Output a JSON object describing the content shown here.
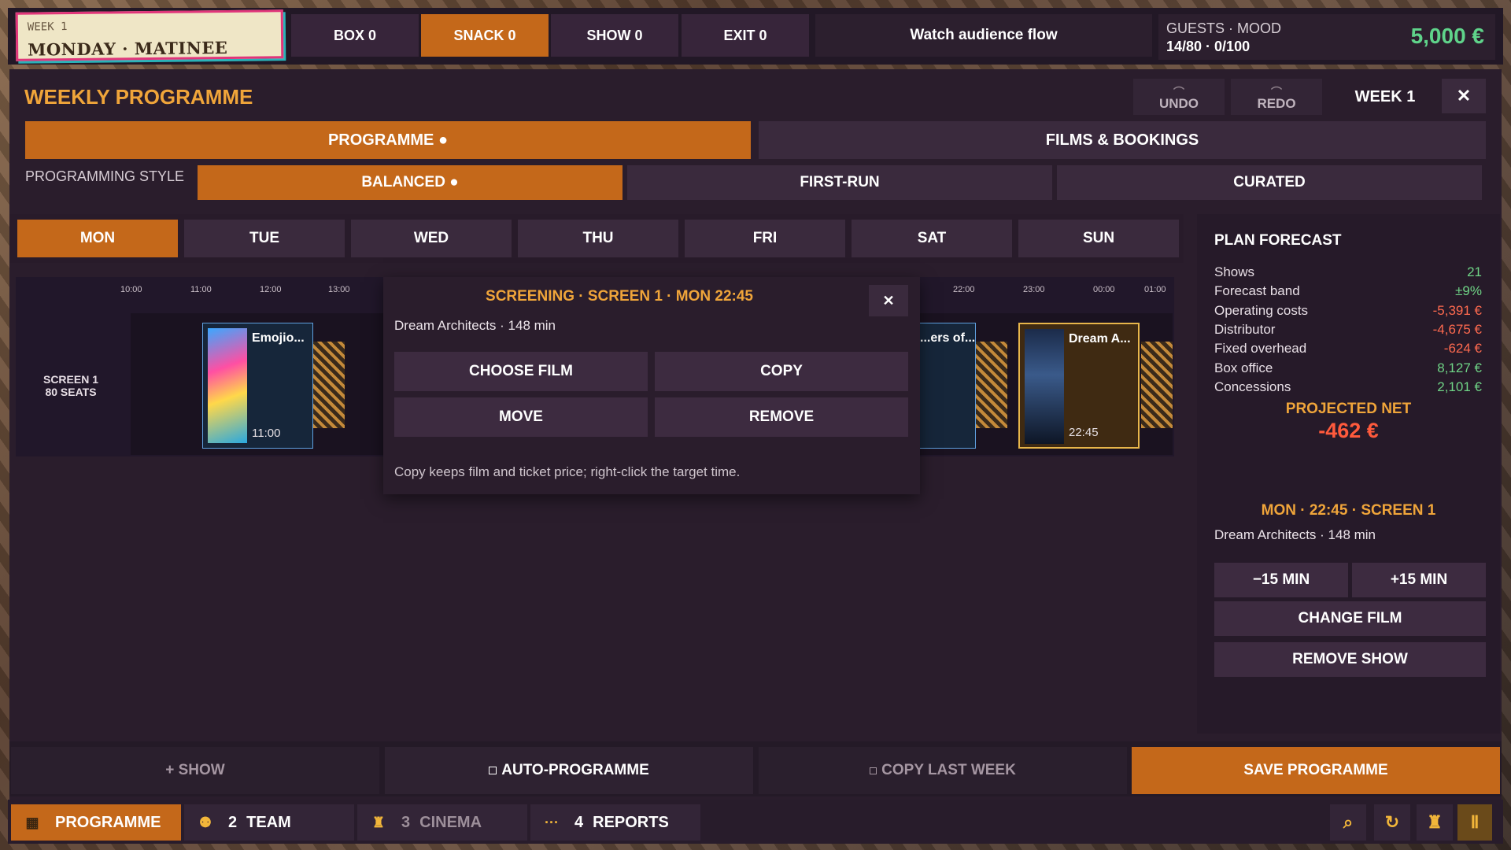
{
  "header": {
    "week_tag": "WEEK 1",
    "day_slot": "MONDAY · MATINEE",
    "counters": [
      {
        "label": "BOX 0",
        "active": false
      },
      {
        "label": "SNACK 0",
        "active": true
      },
      {
        "label": "SHOW 0",
        "active": false
      },
      {
        "label": "EXIT 0",
        "active": false
      }
    ],
    "flow_button": "Watch audience flow",
    "stats_label": "GUESTS · MOOD",
    "stats_value": "14/80 · 0/100",
    "money": "5,000 €"
  },
  "programme": {
    "title": "WEEKLY PROGRAMME",
    "undo_label": "UNDO",
    "redo_label": "REDO",
    "week_label": "WEEK 1",
    "close_glyph": "✕",
    "tabs": [
      "PROGRAMME ●",
      "FILMS & BOOKINGS"
    ],
    "style_label": "PROGRAMMING STYLE",
    "styles": [
      "BALANCED ●",
      "FIRST-RUN",
      "CURATED"
    ],
    "days": [
      "MON",
      "TUE",
      "WED",
      "THU",
      "FRI",
      "SAT",
      "SUN"
    ],
    "active_day": "MON"
  },
  "timeline": {
    "ticks": [
      "10:00",
      "11:00",
      "12:00",
      "13:00",
      "22:00",
      "23:00",
      "00:00",
      "01:00"
    ],
    "screen_name": "SCREEN 1",
    "screen_seats": "80 SEATS",
    "shows": [
      {
        "title": "Emojio...",
        "time": "11:00"
      },
      {
        "title": "...ers of...",
        "time": ""
      },
      {
        "title": "Dream A...",
        "time": "22:45"
      }
    ]
  },
  "popup": {
    "title": "SCREENING · SCREEN 1 · MON 22:45",
    "close_glyph": "✕",
    "film_info": "Dream Architects · 148 min",
    "buttons": [
      "CHOOSE FILM",
      "COPY",
      "MOVE",
      "REMOVE"
    ],
    "hint": "Copy keeps film and ticket price; right-click the target time."
  },
  "forecast": {
    "title": "PLAN FORECAST",
    "rows": [
      {
        "label": "Shows",
        "value": "21",
        "tone": "pos"
      },
      {
        "label": "Forecast band",
        "value": "±9%",
        "tone": "pos"
      },
      {
        "label": "Operating costs",
        "value": "-5,391 €",
        "tone": "neg"
      },
      {
        "label": "Distributor",
        "value": "-4,675 €",
        "tone": "neg"
      },
      {
        "label": "Fixed overhead",
        "value": "-624 €",
        "tone": "neg"
      },
      {
        "label": "Box office",
        "value": "8,127 €",
        "tone": "pos"
      },
      {
        "label": "Concessions",
        "value": "2,101 €",
        "tone": "pos"
      }
    ],
    "projected_label": "PROJECTED NET",
    "projected_value": "-462 €",
    "selection_title": "MON · 22:45 · SCREEN 1",
    "selection_film": "Dream Architects · 148 min",
    "minus_label": "−15 MIN",
    "plus_label": "+15 MIN",
    "change_label": "CHANGE FILM",
    "remove_label": "REMOVE SHOW"
  },
  "actions": {
    "add_show": "+ SHOW",
    "auto": "AUTO-PROGRAMME",
    "copy_last": "COPY LAST WEEK",
    "save": "SAVE PROGRAMME"
  },
  "nav": {
    "items": [
      {
        "num": "",
        "label": "PROGRAMME"
      },
      {
        "num": "2",
        "label": "TEAM"
      },
      {
        "num": "3",
        "label": "CINEMA"
      },
      {
        "num": "4",
        "label": "REPORTS"
      }
    ]
  },
  "colors": {
    "accent": "#c4681a",
    "title": "#f0a53a",
    "positive": "#6fd486",
    "negative": "#ff6a4f",
    "money": "#5fd38a"
  }
}
